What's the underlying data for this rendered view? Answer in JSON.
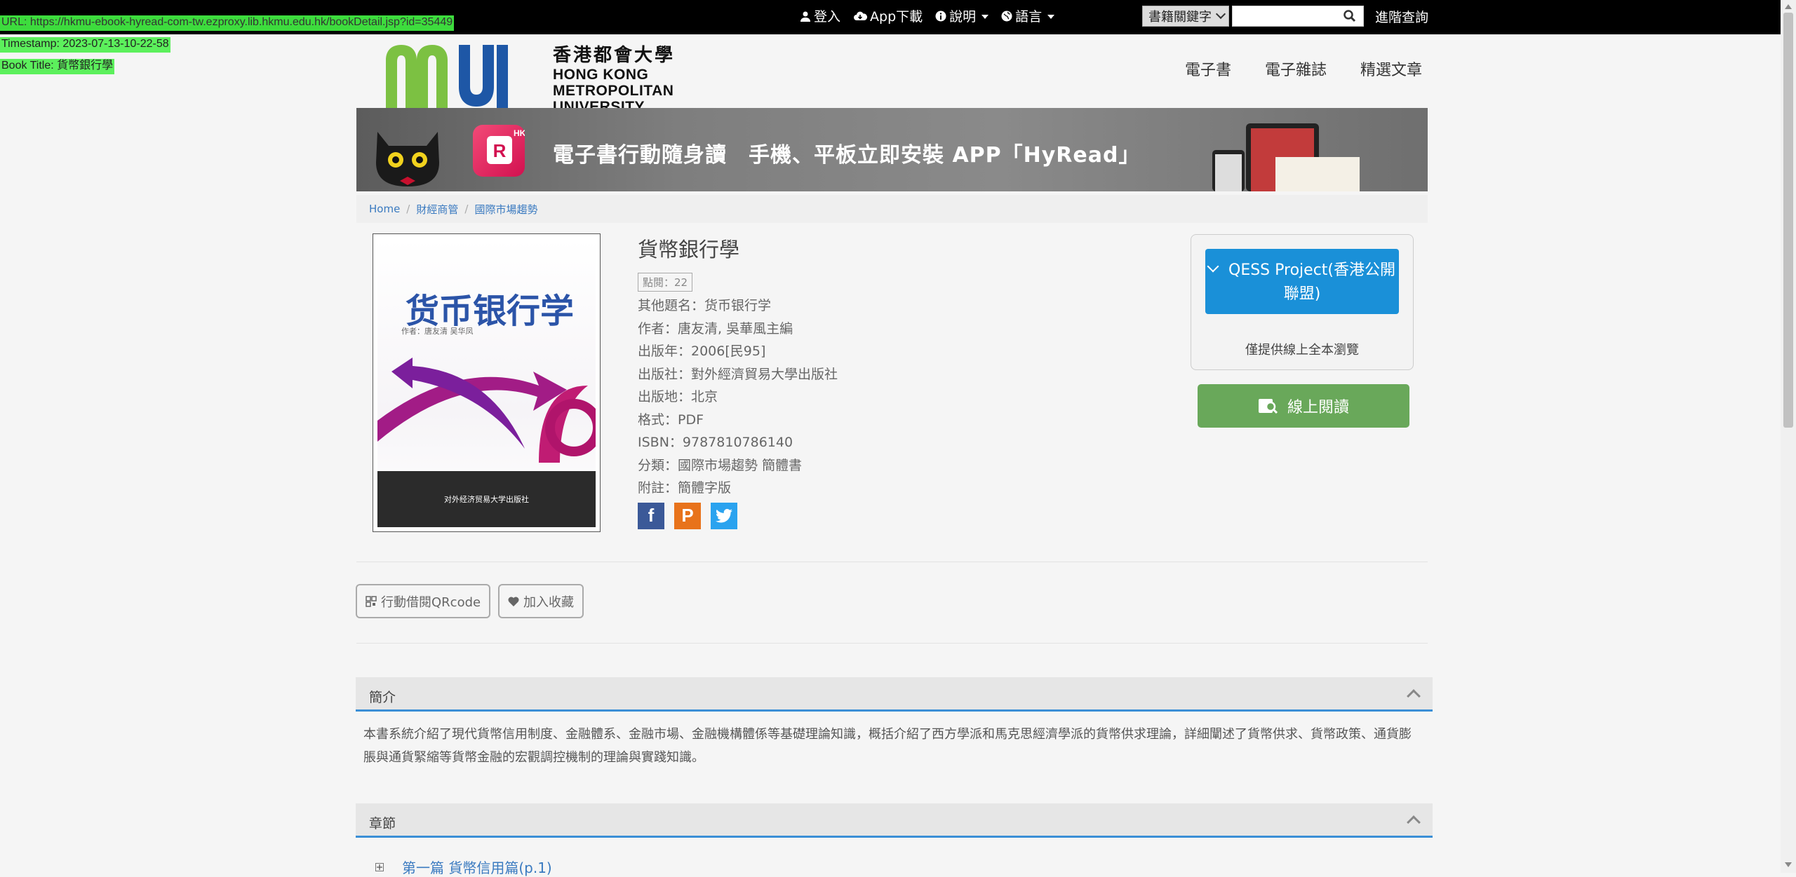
{
  "overlay": {
    "url": "URL: https://hkmu-ebook-hyread-com-tw.ezproxy.lib.hkmu.edu.hk/bookDetail.jsp?id=35449",
    "timestamp": "Timestamp: 2023-07-13-10-22-58",
    "book_title": "Book Title: 貨幣銀行學"
  },
  "topbar": {
    "login": "登入",
    "app_download": "App下載",
    "help": "說明",
    "language": "語言",
    "search_select": "書籍關鍵字",
    "search_placeholder": "",
    "advanced_search": "進階查詢",
    "icons": [
      "user-icon",
      "cloud-download-icon",
      "info-icon",
      "globe-icon",
      "search-icon"
    ]
  },
  "header": {
    "logo_zh": "香港都會大學",
    "logo_en_1": "HONG KONG",
    "logo_en_2": "METROPOLITAN",
    "logo_en_3": "UNIVERSITY",
    "nav": [
      "電子書",
      "電子雜誌",
      "精選文章"
    ]
  },
  "banner": {
    "text": "電子書行動隨身讀　手機、平板立即安裝 APP「HyRead」",
    "badge": "HK"
  },
  "breadcrumb": [
    "Home",
    "財經商管",
    "國際市場趨勢"
  ],
  "cover": {
    "title": "货币银行学",
    "author": "作者：唐友清  吴华凤",
    "publisher": "对外经济贸易大学出版社"
  },
  "book": {
    "title": "貨幣銀行學",
    "hits": "點閱：22",
    "other_title": "其他題名：货币银行学",
    "author": "作者：唐友清, 吳華風主編",
    "year": "出版年：2006[民95]",
    "publisher": "出版社：對外經濟貿易大學出版社",
    "place": "出版地：北京",
    "format": "格式：PDF",
    "isbn": "ISBN：9787810786140",
    "category": "分類：國際市場趨勢  簡體書",
    "note": "附註：簡體字版"
  },
  "side": {
    "qess_button": "QESS Project(香港公開聯盟)",
    "note": "僅提供線上全本瀏覽",
    "read_online": "線上閱讀"
  },
  "actions": {
    "qrcode": "行動借閱QRcode",
    "favorite": "加入收藏"
  },
  "summary": {
    "heading": "簡介",
    "text": "本書系統介紹了現代貨幣信用制度、金融體系、金融市場、金融機構體係等基礎理論知識，概括介紹了西方學派和馬克思經濟學派的貨幣供求理論，詳細闡述了貨幣供求、貨幣政策、通貨膨脹與通貨緊縮等貨幣金融的宏觀調控機制的理論與實踐知識。"
  },
  "chapters": {
    "heading": "章節",
    "first": "第一篇 貨幣信用篇(p.1)"
  },
  "colors": {
    "topbar": "#000000",
    "link": "#3a7ac0",
    "qess_blue": "#1a90d8",
    "read_green": "#69a85a",
    "panel_accent": "#3b8fd6"
  }
}
